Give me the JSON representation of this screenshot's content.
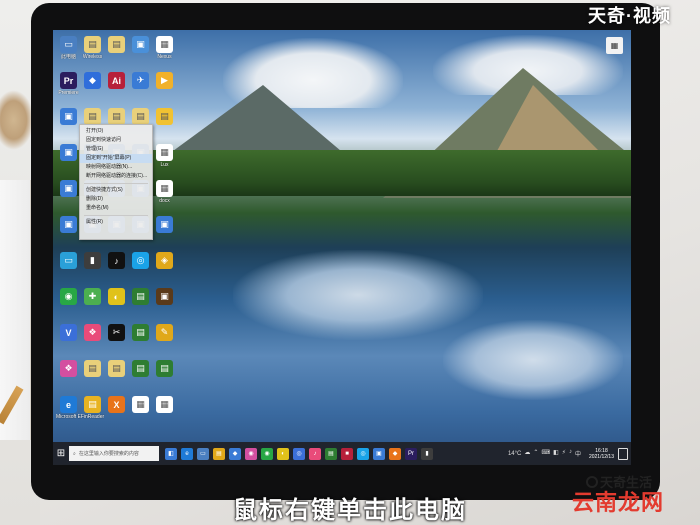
{
  "watermark_top": "天奇·视频",
  "subtitle": "鼠标右键单击此电脑",
  "logo_bottom": {
    "line1": "天奇生活",
    "line2": "云南龙网"
  },
  "desktop": {
    "icons": [
      {
        "name": "此电脑",
        "color": "#4a7fc1",
        "glyph": "▭"
      },
      {
        "name": "Wireless",
        "color": "#e9d07a",
        "glyph": "▤"
      },
      {
        "name": "",
        "color": "#e9d07a",
        "glyph": "▤"
      },
      {
        "name": "",
        "color": "#4a90d9",
        "glyph": "▣"
      },
      {
        "name": "Nexus",
        "color": "#ffffff",
        "glyph": "▦"
      },
      {
        "name": "Premiere",
        "color": "#2b1d5e",
        "glyph": "Pr"
      },
      {
        "name": "",
        "color": "#2f6edb",
        "glyph": "◆"
      },
      {
        "name": "",
        "color": "#b7203a",
        "glyph": "Ai"
      },
      {
        "name": "",
        "color": "#3a7bd5",
        "glyph": "✈"
      },
      {
        "name": "",
        "color": "#f1b12a",
        "glyph": "▶"
      },
      {
        "name": "",
        "color": "#3a7bd5",
        "glyph": "▣"
      },
      {
        "name": "",
        "color": "#e9d07a",
        "glyph": "▤"
      },
      {
        "name": "",
        "color": "#e9d07a",
        "glyph": "▤"
      },
      {
        "name": "",
        "color": "#e9d07a",
        "glyph": "▤"
      },
      {
        "name": "",
        "color": "#f1c232",
        "glyph": "▤"
      },
      {
        "name": "",
        "color": "#3a7bd5",
        "glyph": "▣"
      },
      {
        "name": "",
        "color": "#3a7bd5",
        "glyph": "▣"
      },
      {
        "name": "",
        "color": "#3a7bd5",
        "glyph": "▣"
      },
      {
        "name": "",
        "color": "#3a7bd5",
        "glyph": "▣"
      },
      {
        "name": "Lux",
        "color": "#ffffff",
        "glyph": "▦"
      },
      {
        "name": "",
        "color": "#3a7bd5",
        "glyph": "▣"
      },
      {
        "name": "",
        "color": "#3a7bd5",
        "glyph": "▣"
      },
      {
        "name": "",
        "color": "#3a7bd5",
        "glyph": "▣"
      },
      {
        "name": "",
        "color": "#3a7bd5",
        "glyph": "▣"
      },
      {
        "name": "docx",
        "color": "#ffffff",
        "glyph": "▦"
      },
      {
        "name": "",
        "color": "#3a7bd5",
        "glyph": "▣"
      },
      {
        "name": "",
        "color": "#3a7bd5",
        "glyph": "▣"
      },
      {
        "name": "",
        "color": "#3a7bd5",
        "glyph": "▣"
      },
      {
        "name": "",
        "color": "#3a7bd5",
        "glyph": "▣"
      },
      {
        "name": "",
        "color": "#3a7bd5",
        "glyph": "▣"
      },
      {
        "name": "",
        "color": "#2aa0d8",
        "glyph": "▭"
      },
      {
        "name": "",
        "color": "#3d3d3d",
        "glyph": "▮"
      },
      {
        "name": "",
        "color": "#111111",
        "glyph": "♪"
      },
      {
        "name": "",
        "color": "#1aa3e8",
        "glyph": "◎"
      },
      {
        "name": "",
        "color": "#e0a81a",
        "glyph": "◈"
      },
      {
        "name": "",
        "color": "#28a745",
        "glyph": "◉"
      },
      {
        "name": "",
        "color": "#4caf50",
        "glyph": "✚"
      },
      {
        "name": "",
        "color": "#e0c21a",
        "glyph": "◐"
      },
      {
        "name": "",
        "color": "#2e7d32",
        "glyph": "▤"
      },
      {
        "name": "",
        "color": "#5a3a1a",
        "glyph": "▣"
      },
      {
        "name": "",
        "color": "#3b6fd8",
        "glyph": "V"
      },
      {
        "name": "",
        "color": "#e94b7a",
        "glyph": "❖"
      },
      {
        "name": "",
        "color": "#111111",
        "glyph": "✂"
      },
      {
        "name": "",
        "color": "#2e7d32",
        "glyph": "▤"
      },
      {
        "name": "",
        "color": "#e0a81a",
        "glyph": "✎"
      },
      {
        "name": "",
        "color": "#d44fa0",
        "glyph": "❖"
      },
      {
        "name": "",
        "color": "#e9d07a",
        "glyph": "▤"
      },
      {
        "name": "",
        "color": "#e9d07a",
        "glyph": "▤"
      },
      {
        "name": "",
        "color": "#2e7d32",
        "glyph": "▤"
      },
      {
        "name": "",
        "color": "#2e7d32",
        "glyph": "▤"
      },
      {
        "name": "Microsoft Edge",
        "color": "#1f7ad6",
        "glyph": "e"
      },
      {
        "name": "FinReader",
        "color": "#e8b321",
        "glyph": "▤"
      },
      {
        "name": "",
        "color": "#e8731a",
        "glyph": "X"
      },
      {
        "name": "",
        "color": "#ffffff",
        "glyph": "▦"
      },
      {
        "name": "",
        "color": "#ffffff",
        "glyph": "▦"
      }
    ]
  },
  "context_menu": {
    "items": [
      {
        "label": "打开(O)",
        "highlight": false
      },
      {
        "label": "固定到快速访问",
        "highlight": false
      },
      {
        "label": "管理(G)",
        "highlight": false
      },
      {
        "label": "固定到\"开始\"屏幕(P)",
        "highlight": true
      },
      {
        "label": "映射网络驱动器(N)...",
        "highlight": false
      },
      {
        "label": "断开网络驱动器的连接(C)...",
        "highlight": false
      },
      {
        "label": "---",
        "highlight": false
      },
      {
        "label": "创建快捷方式(S)",
        "highlight": false
      },
      {
        "label": "删除(D)",
        "highlight": false
      },
      {
        "label": "重命名(M)",
        "highlight": false
      },
      {
        "label": "---",
        "highlight": false
      },
      {
        "label": "属性(R)",
        "highlight": false
      }
    ]
  },
  "top_right_icon": {
    "label": "",
    "glyph": "▦"
  },
  "taskbar": {
    "start_glyph": "⊞",
    "search_placeholder": "在这里输入你要搜索的内容",
    "apps": [
      {
        "color": "#3a7bd5",
        "glyph": "◧"
      },
      {
        "color": "#1f7ad6",
        "glyph": "e"
      },
      {
        "color": "#4a7fc1",
        "glyph": "▭"
      },
      {
        "color": "#e0a81a",
        "glyph": "▤"
      },
      {
        "color": "#3a7bd5",
        "glyph": "◆"
      },
      {
        "color": "#d44fa0",
        "glyph": "◉"
      },
      {
        "color": "#28a745",
        "glyph": "◉"
      },
      {
        "color": "#e0c21a",
        "glyph": "◐"
      },
      {
        "color": "#3b6fd8",
        "glyph": "◎"
      },
      {
        "color": "#e94b7a",
        "glyph": "♪"
      },
      {
        "color": "#2e7d32",
        "glyph": "▤"
      },
      {
        "color": "#b7203a",
        "glyph": "■"
      },
      {
        "color": "#1aa3e8",
        "glyph": "◎"
      },
      {
        "color": "#3a7bd5",
        "glyph": "▣"
      },
      {
        "color": "#e8731a",
        "glyph": "◆"
      },
      {
        "color": "#2b1d5e",
        "glyph": "Pr"
      },
      {
        "color": "#3d3d3d",
        "glyph": "▮"
      }
    ],
    "weather": "14°C",
    "tray_icons": [
      "☁",
      "⌃",
      "⌨",
      "◧",
      "⚡",
      "♪",
      "中"
    ],
    "time": "16:18",
    "date": "2021/12/13"
  }
}
